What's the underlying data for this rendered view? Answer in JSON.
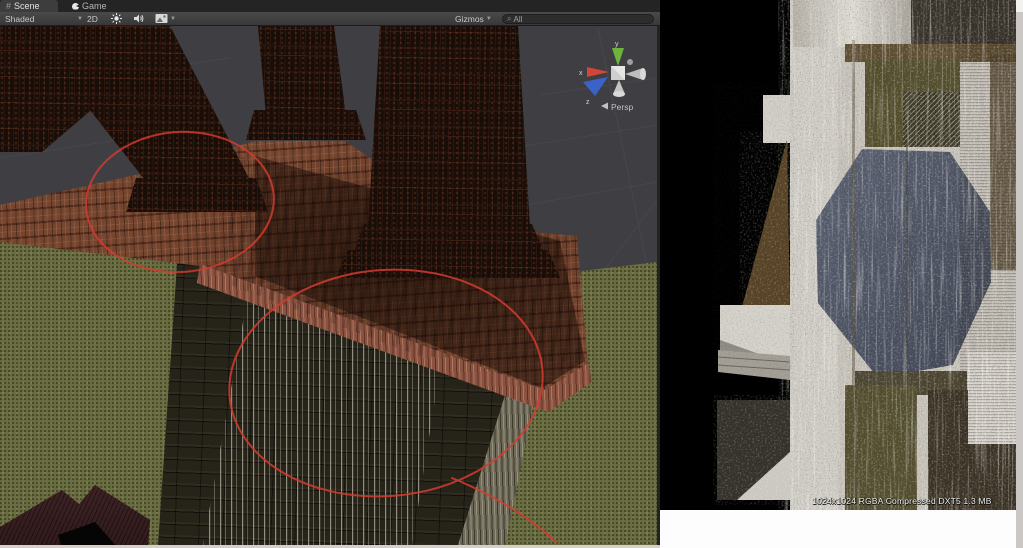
{
  "tabs": {
    "scene": "Scene",
    "game": "Game"
  },
  "toolbar": {
    "shading": "Shaded",
    "toggle_2d": "2D",
    "gizmos": "Gizmos",
    "search_value": "All",
    "icons": [
      "lighting-sun-icon",
      "audio-icon",
      "effects-icon",
      "search-icon"
    ]
  },
  "scene_gizmo": {
    "axis_x": "x",
    "axis_y": "y",
    "axis_z": "z",
    "projection": "Persp"
  },
  "texture_preview": {
    "info": "1024x1024 RGBA Compressed DXT5  1.3 MB"
  },
  "annotations": {
    "count": 2,
    "color": "#d63c30",
    "style": "hand-drawn red ellipses"
  },
  "colors": {
    "annotation_red": "#d63c30",
    "axis_x_red": "#d44536",
    "axis_y_green": "#6cb43c",
    "axis_z_blue": "#3a62c9",
    "scene_background": "#3f3f43",
    "grass": "#6b6d42",
    "platform_wood": "#74452f"
  }
}
